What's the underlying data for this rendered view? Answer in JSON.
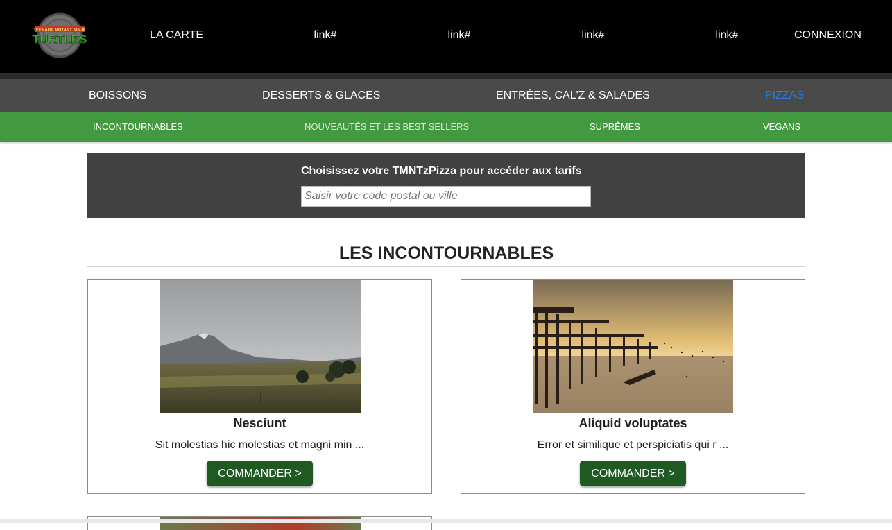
{
  "header": {
    "logo_alt": "Teenage Mutant Ninja Turtles",
    "nav": [
      {
        "label": "LA CARTE"
      },
      {
        "label": "link#"
      },
      {
        "label": "link#"
      },
      {
        "label": "link#"
      },
      {
        "label": "link#"
      },
      {
        "label": "CONNEXION"
      }
    ]
  },
  "categories": [
    {
      "label": "BOISSONS",
      "active": false
    },
    {
      "label": "DESSERTS & GLACES",
      "active": false
    },
    {
      "label": "ENTRÉES, CAL'Z & SALADES",
      "active": false
    },
    {
      "label": "PIZZAS",
      "active": true
    }
  ],
  "subcategories": [
    {
      "label": "INCONTOURNABLES"
    },
    {
      "label": "NOUVEAUTÉS ET LES BEST SELLERS"
    },
    {
      "label": "SUPRÊMES"
    },
    {
      "label": "VEGANS"
    }
  ],
  "search": {
    "title": "Choisissez votre TMNTzPizza pour accéder aux tarifs",
    "placeholder": "Saisir votre code postal ou ville",
    "value": ""
  },
  "section": {
    "title_bold": "LES",
    "title_rest": "INCONTOURNABLES"
  },
  "products": [
    {
      "name": "Nesciunt",
      "description": "Sit molestias hic molestias et magni min ...",
      "button": "COMMANDER >",
      "image": "mountain-landscape-photo"
    },
    {
      "name": "Aliquid voluptates",
      "description": "Error et similique et perspiciatis qui r ...",
      "button": "COMMANDER >",
      "image": "ruined-pier-sunset-photo"
    }
  ],
  "colors": {
    "topbar": "#000000",
    "category_bar": "#4a4a4a",
    "active_category": "#1e7df0",
    "subcategory_bar": "#43993f",
    "search_panel": "#414141",
    "button": "#1f5a23"
  }
}
